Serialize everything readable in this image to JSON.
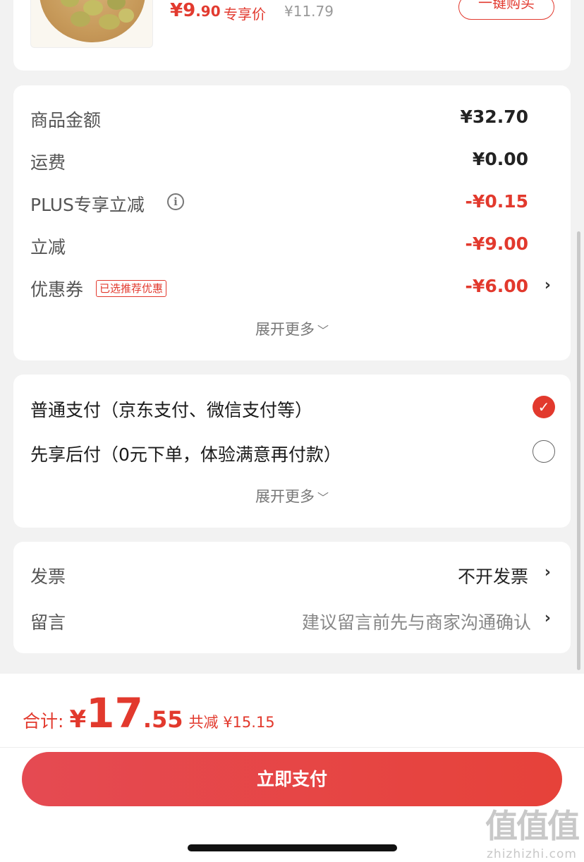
{
  "product": {
    "price_int": "¥9",
    "price_dec": ".90",
    "exclusive_label": "专享价",
    "original_price": "¥11.79",
    "buy_button": "一键购买"
  },
  "summary": {
    "rows": [
      {
        "label": "商品金额",
        "value": "¥32.70"
      },
      {
        "label": "运费",
        "value": "¥0.00"
      },
      {
        "label": "PLUS专享立减",
        "value": "-¥0.15"
      },
      {
        "label": "立减",
        "value": "-¥9.00"
      },
      {
        "label": "优惠券",
        "tag": "已选推荐优惠",
        "value": "-¥6.00"
      }
    ],
    "expand_label": "展开更多"
  },
  "payment": {
    "options": [
      {
        "label": "普通支付（京东支付、微信支付等）",
        "checked": true
      },
      {
        "label": "先享后付（0元下单，体验满意再付款）",
        "checked": false
      }
    ],
    "expand_label": "展开更多"
  },
  "invoice": {
    "invoice_label": "发票",
    "invoice_value": "不开发票",
    "message_label": "留言",
    "message_placeholder": "建议留言前先与商家沟通确认"
  },
  "footer": {
    "total_label": "合计:",
    "total_yen": "¥",
    "total_int": "17",
    "total_dec": ".55",
    "total_saved": "共减 ¥15.15",
    "pay_button": "立即支付"
  },
  "watermark": {
    "big": "值值值",
    "small": "zhizhizhi.com"
  },
  "colors": {
    "accent": "#e2392d",
    "background": "#f2f2f2"
  }
}
